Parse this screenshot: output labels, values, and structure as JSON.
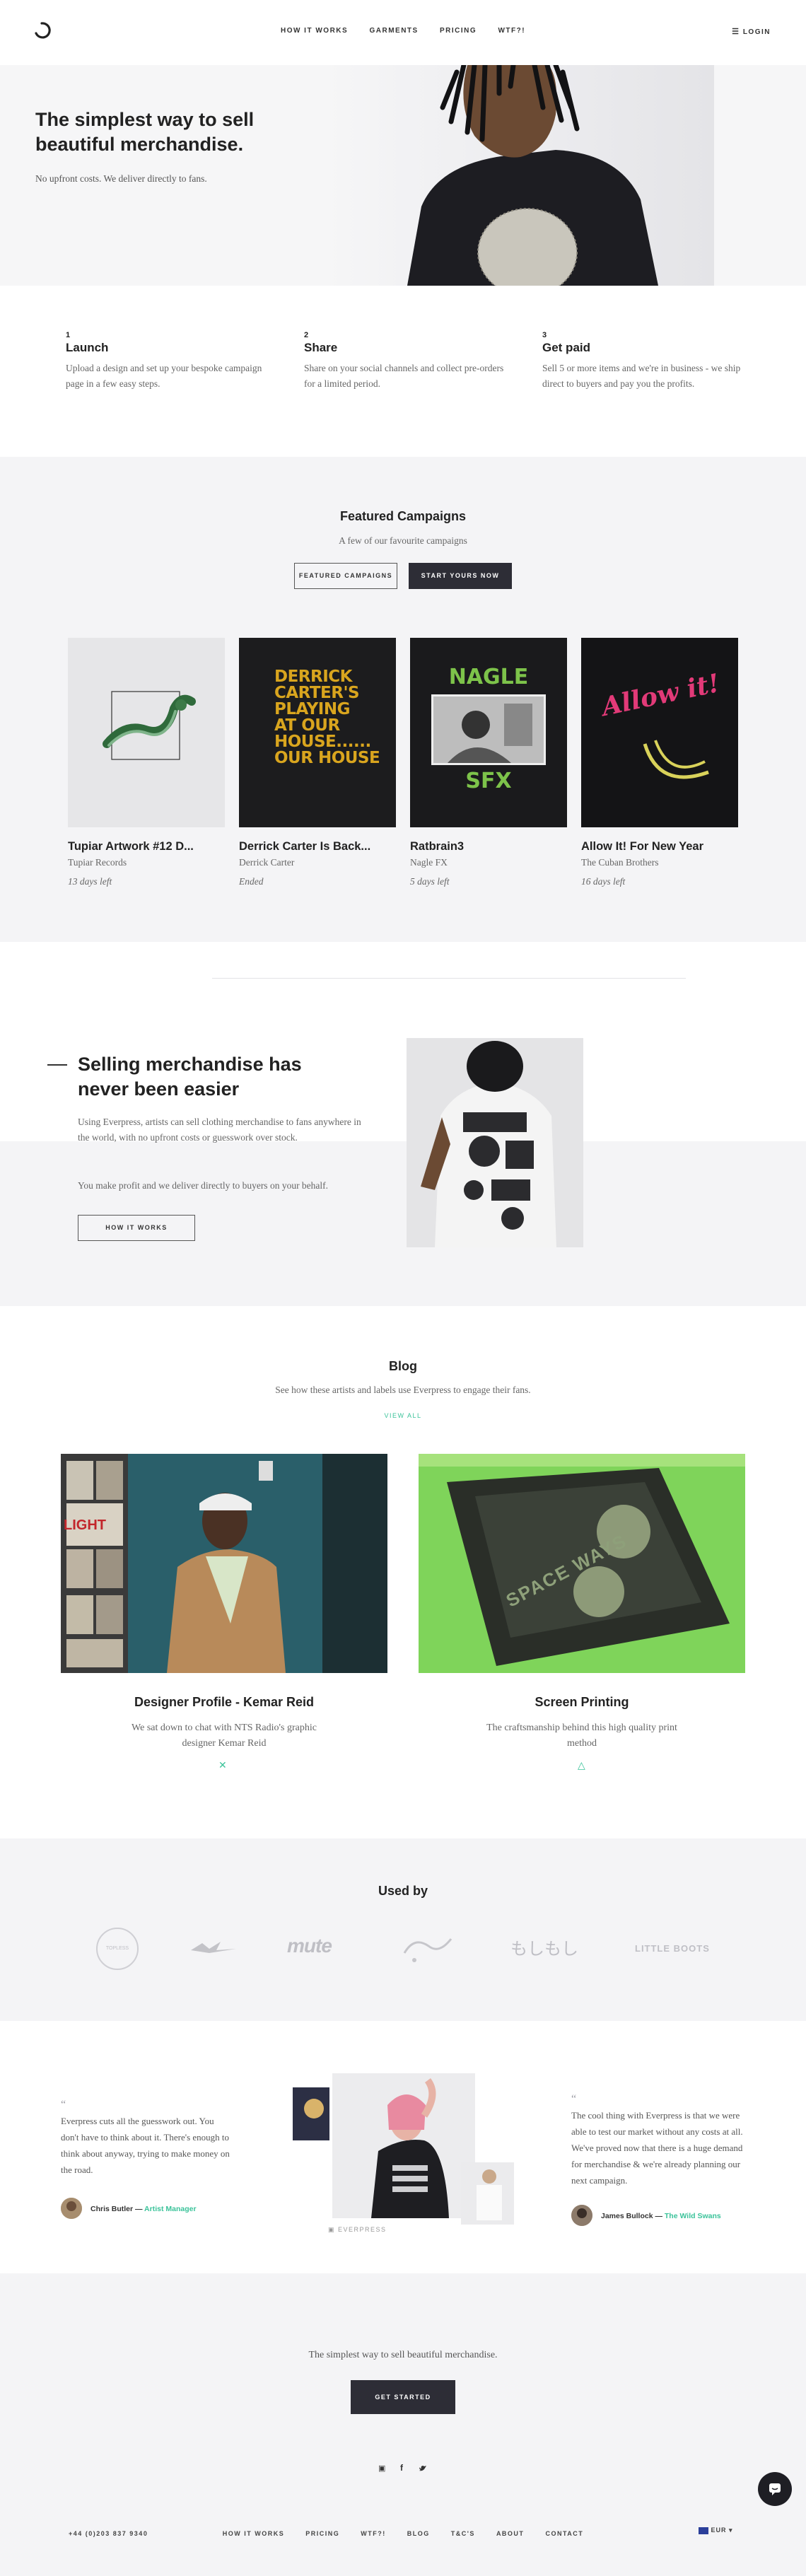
{
  "header": {
    "nav": [
      "HOW IT WORKS",
      "GARMENTS",
      "PRICING",
      "WTF?!"
    ],
    "login": "LOGIN"
  },
  "hero": {
    "title": "The simplest way to sell beautiful merchandise.",
    "subtitle": "No upfront costs. We deliver directly to fans."
  },
  "steps": [
    {
      "num": "1",
      "title": "Launch",
      "text": "Upload a design and set up your bespoke campaign page in a few easy steps."
    },
    {
      "num": "2",
      "title": "Share",
      "text": "Share on your social channels and collect pre-orders for a limited period."
    },
    {
      "num": "3",
      "title": "Get paid",
      "text": "Sell 5 or more items and we're in business - we ship direct to buyers and pay you the profits."
    }
  ],
  "featured": {
    "title": "Featured Campaigns",
    "subtitle": "A few of our favourite campaigns",
    "btn_featured": "FEATURED CAMPAIGNS",
    "btn_start": "START YOURS NOW",
    "campaigns": [
      {
        "title": "Tupiar Artwork #12 D...",
        "by": "Tupiar Records",
        "left": "13 days left"
      },
      {
        "title": "Derrick Carter Is Back...",
        "by": "Derrick Carter",
        "left": "Ended",
        "art": [
          "DERRICK",
          "CARTER'S",
          "PLAYING",
          "AT OUR",
          "HOUSE......",
          "OUR HOUSE"
        ]
      },
      {
        "title": "Ratbrain3",
        "by": "Nagle FX",
        "left": "5 days left",
        "art_top": "NAGLE",
        "art_bottom": "SFX"
      },
      {
        "title": "Allow It! For New Year",
        "by": "The Cuban Brothers",
        "left": "16 days left",
        "art": "Allow it!"
      }
    ]
  },
  "selling": {
    "title": "Selling merchandise has never been easier",
    "p1": "Using Everpress, artists can sell clothing merchandise to fans anywhere in the world, with no upfront costs or guesswork over stock.",
    "p2": "You make profit and we deliver directly to buyers on your behalf.",
    "button": "HOW IT WORKS"
  },
  "blog": {
    "title": "Blog",
    "subtitle": "See how these artists and labels use Everpress to engage their fans.",
    "view_all": "VIEW ALL",
    "posts": [
      {
        "title": "Designer Profile - Kemar Reid",
        "desc": "We sat down to chat with NTS Radio's graphic designer Kemar Reid",
        "poster_text": "LIGHT"
      },
      {
        "title": "Screen Printing",
        "desc": "The craftsmanship behind this high quality print method",
        "screen_text": "SPACE WAYS"
      }
    ]
  },
  "used_by": {
    "title": "Used by",
    "logos": [
      "TOPLESS",
      "mute",
      "もしもし",
      "LITTLE BOOTS"
    ]
  },
  "testimonials": [
    {
      "quote": "Everpress cuts all the guesswork out. You don't have to think about it. There's enough to think about anyway, trying to make money on the road.",
      "name": "Chris Butler",
      "role": "Artist Manager"
    },
    {
      "quote": "The cool thing with Everpress is that we were able to test our market without any costs at all. We've proved now that there is a huge demand for merchandise & we're already planning our next campaign.",
      "name": "James Bullock",
      "role": "The Wild Swans"
    }
  ],
  "instagram_tag": "EVERPRESS",
  "cta": {
    "text": "The simplest way to sell beautiful merchandise.",
    "button": "GET STARTED"
  },
  "footer": {
    "phone": "+44 (0)203 837 9340",
    "links": [
      "HOW IT WORKS",
      "PRICING",
      "WTF?!",
      "BLOG",
      "T&C'S",
      "ABOUT",
      "CONTACT"
    ],
    "currency": "EUR"
  },
  "colors": {
    "accent": "#3bc39a",
    "dark": "#2d2d36",
    "section_bg": "#f4f4f6"
  }
}
